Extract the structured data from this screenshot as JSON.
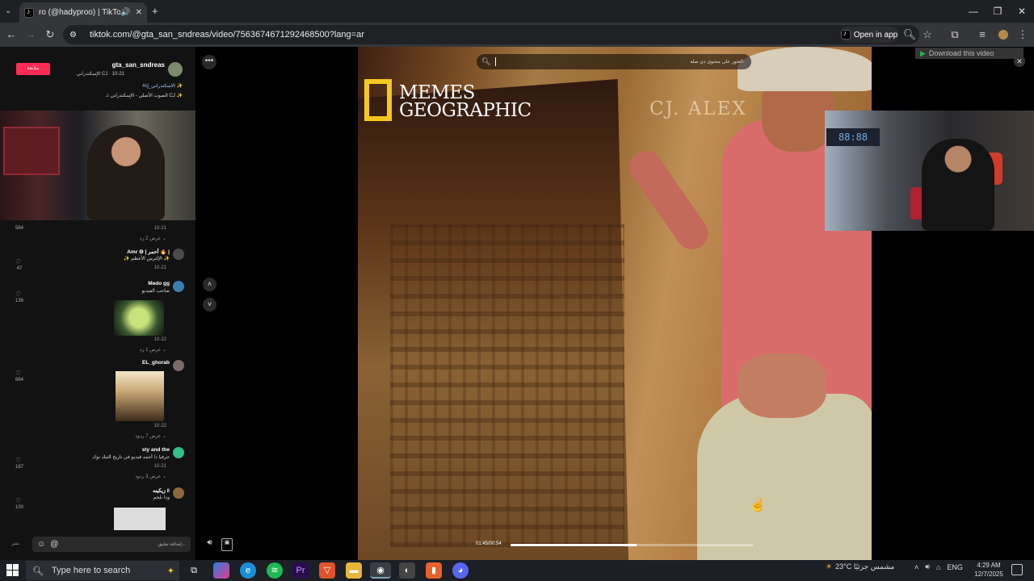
{
  "browser": {
    "tab_title": "ro (@hadyproo) | TikTok(6)",
    "url": "tiktok.com/@gta_san_sndreas/video/7563674671292468500?lang=ar",
    "open_in_app": "Open in app",
    "new_tab": "+",
    "controls": {
      "minimize": "—",
      "restore": "❐",
      "close": "✕"
    }
  },
  "sidebar": {
    "follow_label": "متابعة",
    "author_name": "gta_san_sndreas",
    "author_sub": "الإسكندراني CJ · 10-21",
    "tag": "#cj_الاسكندراني ✨",
    "sound": "♫ الصوت الأصلي - الإسكندراني CJ ✨",
    "more": "•••",
    "comments": [
      {
        "user": "",
        "text": "10-21",
        "date": "",
        "replies": "عرض 2 رد ⌄",
        "likes": "584"
      },
      {
        "user": "Amr ⚙ | أحمر 🔥 |",
        "text": "✨ الإلترس الأعظم ✨",
        "date": "10-21",
        "replies": "",
        "likes": "47"
      },
      {
        "user": "Medo gg",
        "text": "صاحب الفيديو",
        "date": "10-22",
        "replies": "عرض 1 رد ⌄",
        "likes": "136"
      },
      {
        "user": "EL_ghorab",
        "text": "",
        "date": "10-22",
        "replies": "عرض 7 ردود ⌄",
        "likes": "664"
      },
      {
        "user": "sty and the",
        "text": "حرفيا دا أجمد فيديو في تاريخ التيك توك",
        "date": "10-21",
        "replies": "عرض 3 ردود ⌄",
        "likes": "167"
      },
      {
        "user": "زيكينه ‖",
        "text": "ودا بلحم",
        "date": "",
        "replies": "",
        "likes": "100"
      }
    ],
    "comment_placeholder": "إضافة تعليق...",
    "send_label": "نشر",
    "emoji": "☺",
    "mention": "@"
  },
  "video": {
    "logo_line1": "MEMES",
    "logo_line2": "GEOGRAPHIC",
    "watermark": "CJ. ALEX",
    "search_text": "العثور على محتوى ذي صلة",
    "time": "01:45/00:54",
    "progress": 0.52,
    "download_label": "Download this video"
  },
  "cam_right": {
    "clock": "88:88"
  },
  "taskbar": {
    "search_placeholder": "Type here to search",
    "weather": "23°C مشمس جزئيًا",
    "lang": "ENG",
    "time": "4:29 AM",
    "date": "12/7/2025"
  }
}
